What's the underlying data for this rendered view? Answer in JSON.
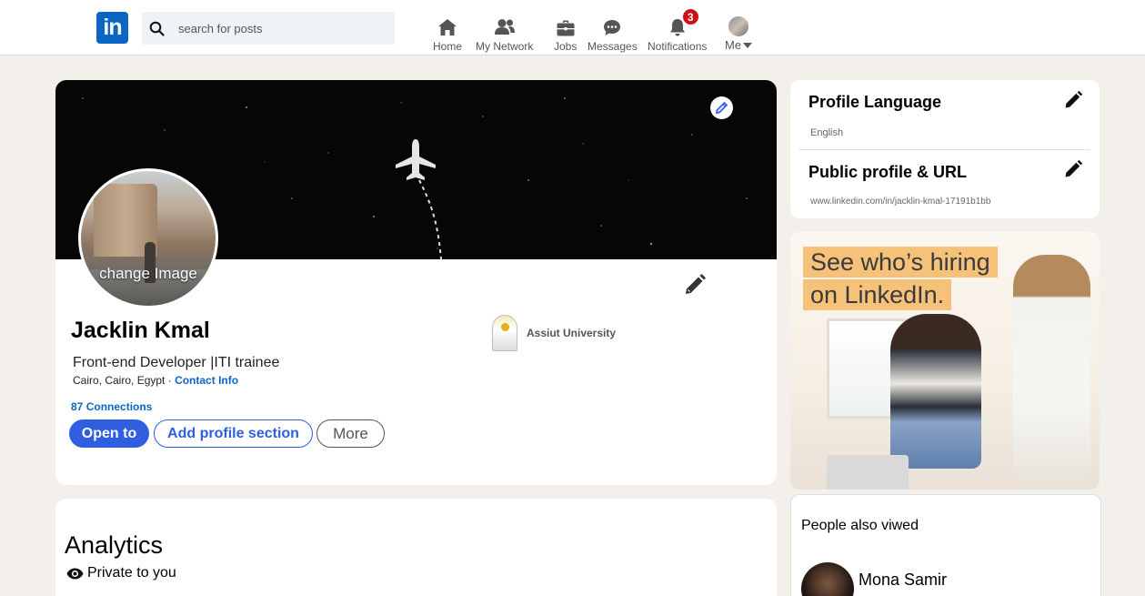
{
  "nav": {
    "logo_text": "in",
    "search_placeholder": "search for posts",
    "items": [
      {
        "label": "Home",
        "icon": "home-icon"
      },
      {
        "label": "My Network",
        "icon": "network-icon"
      },
      {
        "label": "Jobs",
        "icon": "briefcase-icon"
      },
      {
        "label": "Messages",
        "icon": "messages-icon"
      },
      {
        "label": "Notifications",
        "icon": "bell-icon",
        "badge": "3"
      },
      {
        "label": "Me",
        "icon": "me-avatar"
      }
    ]
  },
  "profile": {
    "change_image_label": "change Image",
    "name": "Jacklin Kmal",
    "headline": "Front-end Developer |ITI trainee",
    "location": "Cairo, Cairo, Egypt",
    "location_separator": "·",
    "contact_info_label": "Contact Info",
    "connections_count": "87",
    "connections_label": "Connections",
    "university": "Assiut University",
    "buttons": {
      "open_to": "Open to",
      "add_section": "Add profile section",
      "more": "More"
    }
  },
  "analytics": {
    "title": "Analytics",
    "private_label": "Private to you"
  },
  "sidebar": {
    "profile_language_title": "Profile Language",
    "profile_language_value": "English",
    "public_profile_title": "Public profile & URL",
    "public_profile_url": "www.linkedin.com/in/jacklin-kmal-17191b1bb",
    "ad_line1": "See who’s hiring",
    "ad_line2": "on LinkedIn.",
    "people_also_viewed_title": "People also viwed",
    "people": [
      {
        "name": "Mona Samir"
      }
    ]
  },
  "colors": {
    "brand": "#0a66c2",
    "primary_button": "#2f5fe0",
    "badge": "#cc1016",
    "ad_highlight": "#f6c27a"
  }
}
